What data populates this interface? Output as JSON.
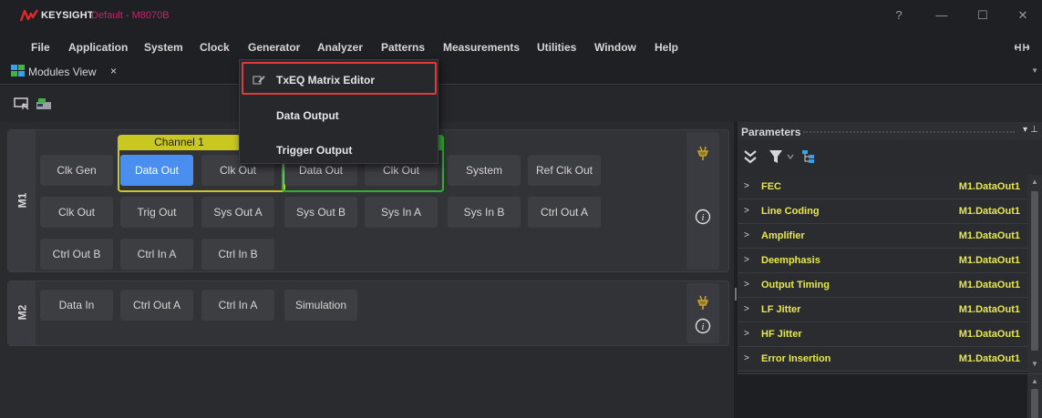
{
  "window": {
    "brand": "KEYSIGHT",
    "title": "Default - M8070B",
    "controls": [
      "?",
      "—",
      "☐",
      "✕"
    ]
  },
  "menubar": {
    "items": [
      "File",
      "Application",
      "System",
      "Clock",
      "Generator",
      "Analyzer",
      "Patterns",
      "Measurements",
      "Utilities",
      "Window",
      "Help"
    ],
    "pin_icon": "pin-icon"
  },
  "tabs": [
    {
      "label": "Modules View",
      "close": "×"
    }
  ],
  "generator_menu": {
    "items": [
      "TxEQ Matrix Editor",
      "Data Output",
      "Trigger Output"
    ],
    "highlighted": "TxEQ Matrix Editor"
  },
  "modules": {
    "m1": {
      "tag": "M1",
      "channel_label": "Channel 1",
      "row1": [
        "Clk Gen",
        "Data Out",
        "Clk Out",
        "Data Out",
        "Clk Out",
        "System",
        "Ref Clk Out"
      ],
      "row2": [
        "Clk Out",
        "Trig Out",
        "Sys Out A",
        "Sys Out B",
        "Sys In A",
        "Sys In B",
        "Ctrl Out A"
      ],
      "row3": [
        "Ctrl Out B",
        "Ctrl In A",
        "Ctrl In B"
      ],
      "active": "Data Out"
    },
    "m2": {
      "tag": "M2",
      "row1": [
        "Data In",
        "Ctrl Out A",
        "Ctrl In A",
        "Simulation"
      ]
    }
  },
  "parameters": {
    "title": "Parameters",
    "controls": [
      "▾",
      "⊥"
    ],
    "rows": [
      {
        "name": "FEC",
        "value": "M1.DataOut1"
      },
      {
        "name": "Line Coding",
        "value": "M1.DataOut1"
      },
      {
        "name": "Amplifier",
        "value": "M1.DataOut1"
      },
      {
        "name": "Deemphasis",
        "value": "M1.DataOut1"
      },
      {
        "name": "Output Timing",
        "value": "M1.DataOut1"
      },
      {
        "name": "LF Jitter",
        "value": "M1.DataOut1"
      },
      {
        "name": "HF Jitter",
        "value": "M1.DataOut1"
      },
      {
        "name": "Error Insertion",
        "value": "M1.DataOut1"
      }
    ]
  },
  "colors": {
    "accent_blue": "#4a8ef0",
    "channel1_yellow": "#c8c820",
    "channel2_green": "#30b030",
    "param_text": "#e8e84a",
    "title_magenta": "#c3256f",
    "menu_highlight": "#e23a3a"
  }
}
